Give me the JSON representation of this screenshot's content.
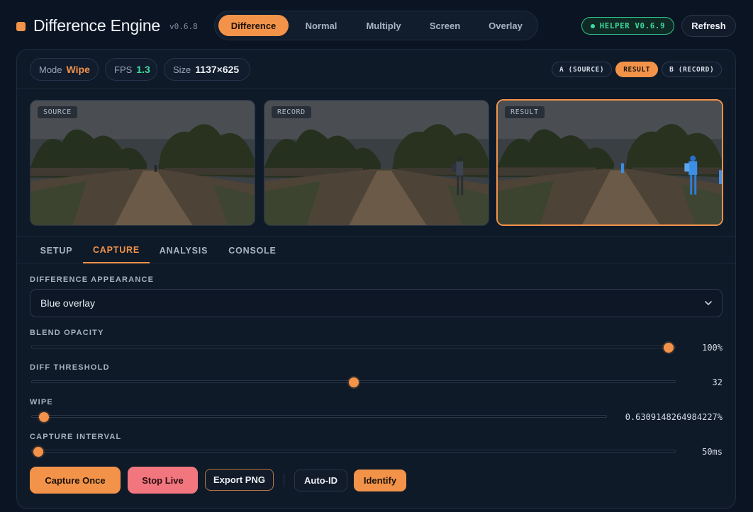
{
  "header": {
    "title": "Difference Engine",
    "version": "v0.6.8",
    "modes": [
      "Difference",
      "Normal",
      "Multiply",
      "Screen",
      "Overlay"
    ],
    "active_mode": "Difference",
    "helper_badge": "HELPER V0.6.9",
    "refresh_label": "Refresh",
    "brand_color": "#f39349",
    "helper_color": "#3fdc9e"
  },
  "stats": {
    "mode": {
      "label": "Mode",
      "value": "Wipe"
    },
    "fps": {
      "label": "FPS",
      "value": "1.3"
    },
    "size": {
      "label": "Size",
      "value": "1137×625"
    }
  },
  "view_tabs": {
    "source": "A (SOURCE)",
    "result": "RESULT",
    "record": "B (RECORD)",
    "active": "RESULT"
  },
  "previews": {
    "source": "SOURCE",
    "record": "RECORD",
    "result": "RESULT"
  },
  "tabs": {
    "setup": "SETUP",
    "capture": "CAPTURE",
    "analysis": "ANALYSIS",
    "console": "CONSOLE",
    "active": "CAPTURE"
  },
  "capture": {
    "appearance_label": "DIFFERENCE APPEARANCE",
    "appearance_value": "Blue overlay",
    "opacity_label": "BLEND OPACITY",
    "opacity_value": "100%",
    "opacity_fraction": 1.0,
    "threshold_label": "DIFF THRESHOLD",
    "threshold_value": "32",
    "threshold_fraction": 0.5,
    "wipe_label": "WIPE",
    "wipe_value": "0.6309148264984227%",
    "wipe_fraction": 0.0063,
    "interval_label": "CAPTURE INTERVAL",
    "interval_value": "50ms",
    "interval_fraction": 0.01
  },
  "actions": {
    "capture_once": "Capture Once",
    "stop_live": "Stop Live",
    "export_png": "Export PNG",
    "auto_id": "Auto-ID",
    "identify": "Identify"
  }
}
